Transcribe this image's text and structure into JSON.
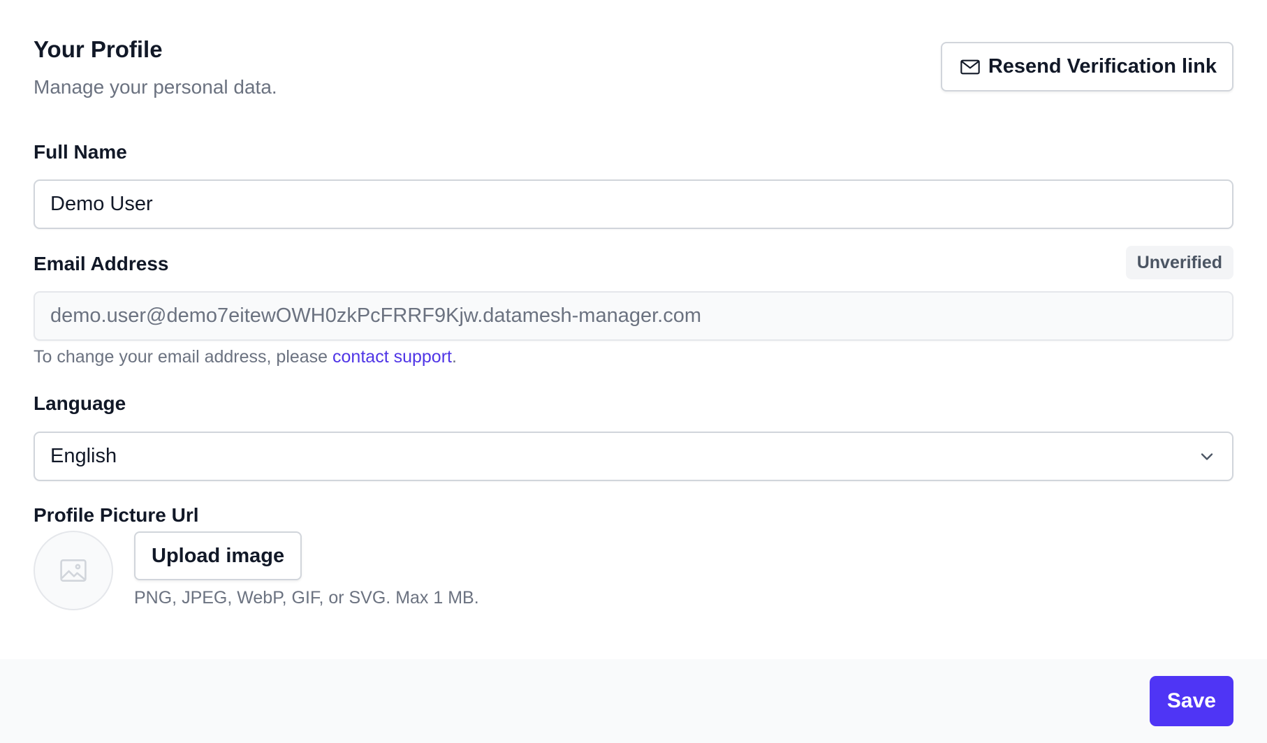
{
  "header": {
    "title": "Your Profile",
    "subtitle": "Manage your personal data.",
    "resend_label": "Resend Verification link",
    "resend_icon": "envelope-icon"
  },
  "full_name": {
    "label": "Full Name",
    "value": "Demo User"
  },
  "email": {
    "label": "Email Address",
    "status_badge": "Unverified",
    "value": "demo.user@demo7eitewOWH0zkPcFRRF9Kjw.datamesh-manager.com",
    "help_prefix": "To change your email address, please ",
    "help_link": "contact support",
    "help_suffix": "."
  },
  "language": {
    "label": "Language",
    "selected": "English",
    "icon": "chevron-down-icon"
  },
  "profile_picture": {
    "label": "Profile Picture Url",
    "placeholder_icon": "image-icon",
    "upload_label": "Upload image",
    "hint": "PNG, JPEG, WebP, GIF, or SVG. Max 1 MB."
  },
  "footer": {
    "save_label": "Save"
  },
  "colors": {
    "accent": "#4f35f5",
    "link": "#4f35e6",
    "muted_text": "#6b7280",
    "footer_bg": "#f9fafb"
  }
}
